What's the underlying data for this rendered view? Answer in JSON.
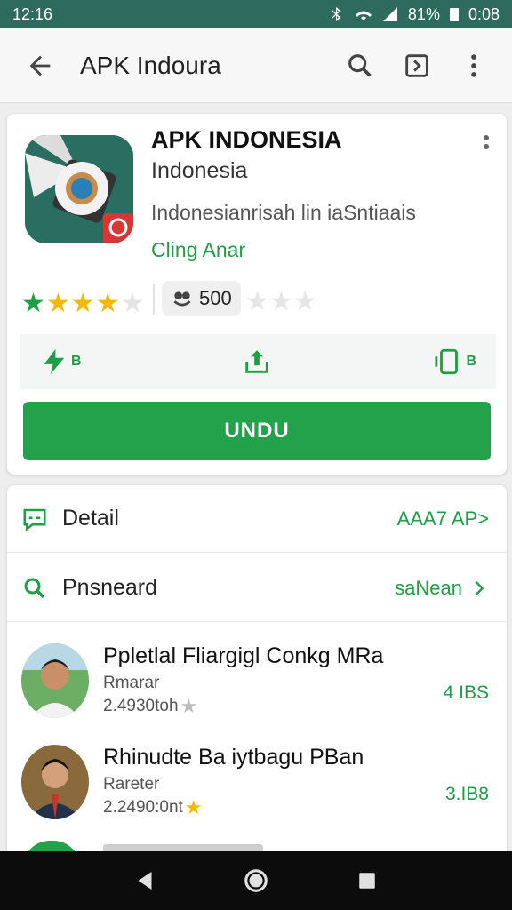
{
  "status": {
    "time": "12:16",
    "battery": "81%",
    "clock": "0:08"
  },
  "appbar": {
    "title": "APK Indoura"
  },
  "app": {
    "name": "APK INDONESIA",
    "developer": "Indonesia",
    "description": "Indonesianrisah lin iaSntiaais",
    "category": "Cling Anar",
    "downloads": "500",
    "action_labels": [
      "B",
      "",
      "B"
    ],
    "install_label": "UNDU"
  },
  "rows": [
    {
      "icon": "chat-icon",
      "label": "Detail",
      "link": "AAA7 AP>"
    },
    {
      "icon": "search-icon",
      "label": "Pnsneard",
      "link": "saNean"
    }
  ],
  "items": [
    {
      "title": "Ppletlal Fliargigl Conkg MRa",
      "sub": "Rmarar",
      "meta": "2.4930toh",
      "size": "4 IBS",
      "star_color": "#bdbdbd"
    },
    {
      "title": "Rhinudte Ba iytbagu PBan",
      "sub": "Rareter",
      "meta": "2.2490:0nt",
      "size": "3.IB8",
      "star_color": "#f5b800"
    }
  ],
  "colors": {
    "accent": "#23a24b",
    "statusbar": "#2e6b5e",
    "rating_gold": "#f5b800"
  }
}
